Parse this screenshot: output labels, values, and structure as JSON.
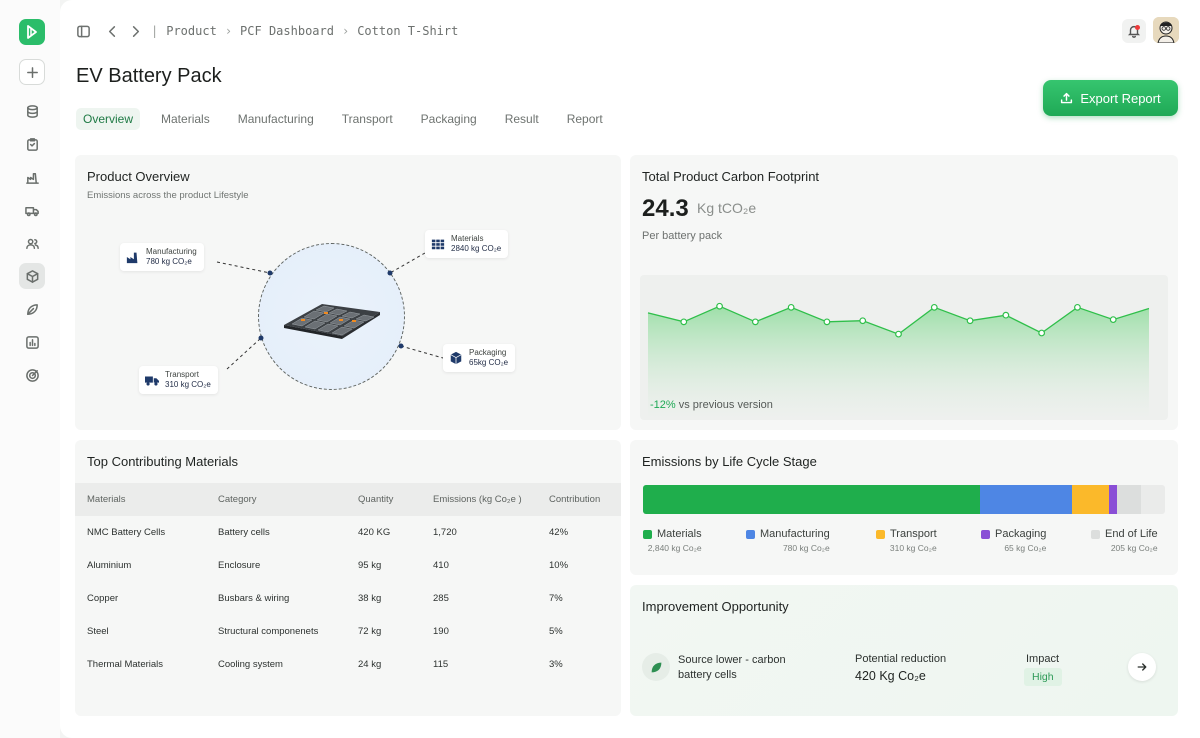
{
  "breadcrumb": [
    "Product",
    "PCF Dashboard",
    "Cotton T-Shirt"
  ],
  "page_title": "EV Battery Pack",
  "tabs": [
    "Overview",
    "Materials",
    "Manufacturing",
    "Transport",
    "Packaging",
    "Result",
    "Report"
  ],
  "active_tab": "Overview",
  "export_label": "Export Report",
  "sidebar_icons": [
    "database-icon",
    "clipboard-icon",
    "factory-icon",
    "truck-icon",
    "users-icon",
    "box-icon",
    "leaf-icon",
    "bar-chart-icon",
    "target-icon"
  ],
  "product_overview": {
    "title": "Product Overview",
    "subtitle": "Emissions across the product Lifestyle",
    "tags": {
      "manufacturing": {
        "label": "Manufacturing",
        "value": "780 kg CO₂e"
      },
      "materials": {
        "label": "Materials",
        "value": "2840 kg CO₂e"
      },
      "packaging": {
        "label": "Packaging",
        "value": "65kg CO₂e"
      },
      "transport": {
        "label": "Transport",
        "value": "310 kg CO₂e"
      }
    }
  },
  "total_pcf": {
    "title": "Total Product Carbon Footprint",
    "value": "24.3",
    "unit": "Kg tCO₂e",
    "sub": "Per battery pack",
    "change": "-12%",
    "change_text": "vs previous version"
  },
  "chart_data": {
    "type": "area",
    "title": "",
    "xlabel": "",
    "ylabel": "",
    "series": [
      {
        "values": [
          24.6,
          23.8,
          25.2,
          23.8,
          25.1,
          23.8,
          23.9,
          22.7,
          25.1,
          23.9,
          24.4,
          22.8,
          25.1,
          24.0,
          25.0
        ]
      }
    ],
    "ylim": [
      15,
      28
    ],
    "grid": false,
    "area_fill": "#9fe0a8",
    "line_color": "#2fbf4a"
  },
  "top_materials": {
    "title": "Top Contributing Materials",
    "columns": [
      "Materials",
      "Category",
      "Quantity",
      "Emissions (kg Co₂e )",
      "Contribution"
    ],
    "rows": [
      [
        "NMC Battery Cells",
        "Battery cells",
        "420 KG",
        "1,720",
        "42%"
      ],
      [
        "Aluminium",
        "Enclosure",
        "95 kg",
        "410",
        "10%"
      ],
      [
        "Copper",
        "Busbars & wiring",
        "38 kg",
        "285",
        "7%"
      ],
      [
        "Steel",
        "Structural componenets",
        "72 kg",
        "190",
        "5%"
      ],
      [
        "Thermal Materials",
        "Cooling system",
        "24 kg",
        "115",
        "3%"
      ]
    ]
  },
  "lifecycle": {
    "title": "Emissions by Life Cycle Stage",
    "stages": [
      {
        "name": "Materials",
        "value": "2,840 kg Co₂e",
        "kg": 2840,
        "color": "#1fae4c"
      },
      {
        "name": "Manufacturing",
        "value": "780 kg Co₂e",
        "kg": 780,
        "color": "#4e86e4"
      },
      {
        "name": "Transport",
        "value": "310 kg Co₂e",
        "kg": 310,
        "color": "#fbb92a"
      },
      {
        "name": "Packaging",
        "value": "65 kg Co₂e",
        "kg": 65,
        "color": "#8a4fd6"
      },
      {
        "name": "End of Life",
        "value": "205 kg Co₂e",
        "kg": 205,
        "color": "#dcdedd"
      }
    ]
  },
  "improvement": {
    "title": "Improvement Opportunity",
    "source": "Source lower - carbon battery cells",
    "reduction_label": "Potential reduction",
    "reduction_value": "420 Kg Co₂e",
    "impact_label": "Impact",
    "impact_value": "High"
  }
}
